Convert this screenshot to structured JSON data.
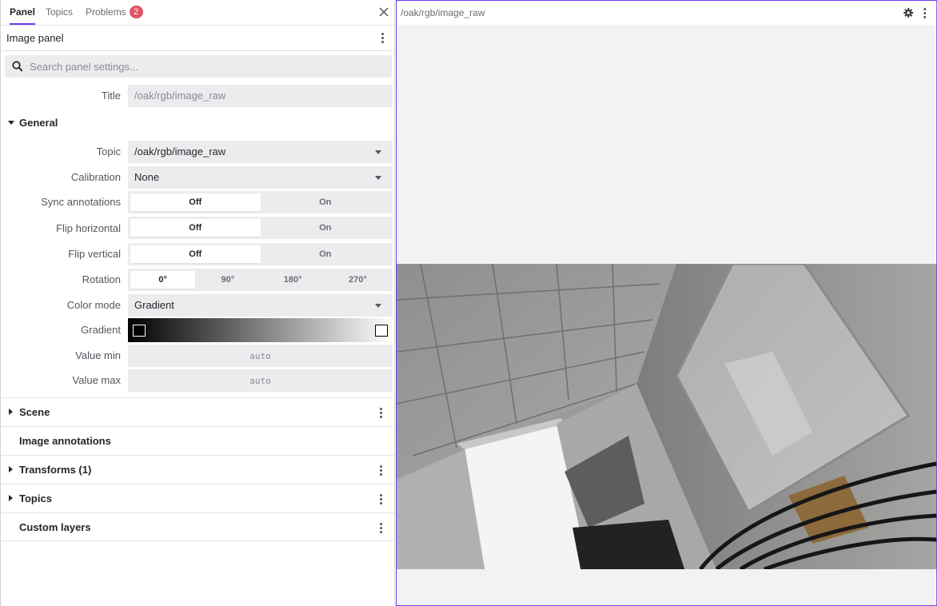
{
  "sidebar": {
    "tabs": [
      {
        "label": "Panel"
      },
      {
        "label": "Topics"
      },
      {
        "label": "Problems",
        "badge": "2"
      }
    ],
    "panel_title": "Image panel",
    "search_placeholder": "Search panel settings...",
    "title_field": {
      "label": "Title",
      "value": "/oak/rgb/image_raw"
    },
    "general": {
      "label": "General",
      "topic": {
        "label": "Topic",
        "value": "/oak/rgb/image_raw"
      },
      "calibration": {
        "label": "Calibration",
        "value": "None"
      },
      "sync_annotations": {
        "label": "Sync annotations",
        "options": [
          "Off",
          "On"
        ],
        "selected": "Off"
      },
      "flip_horizontal": {
        "label": "Flip horizontal",
        "options": [
          "Off",
          "On"
        ],
        "selected": "Off"
      },
      "flip_vertical": {
        "label": "Flip vertical",
        "options": [
          "Off",
          "On"
        ],
        "selected": "Off"
      },
      "rotation": {
        "label": "Rotation",
        "options": [
          "0°",
          "90°",
          "180°",
          "270°"
        ],
        "selected": "0°"
      },
      "color_mode": {
        "label": "Color mode",
        "value": "Gradient"
      },
      "gradient": {
        "label": "Gradient",
        "min_color": "#000000",
        "max_color": "#ffffff"
      },
      "value_min": {
        "label": "Value min",
        "placeholder": "auto"
      },
      "value_max": {
        "label": "Value max",
        "placeholder": "auto"
      }
    },
    "sections": [
      {
        "label": "Scene",
        "expandable": true,
        "menu": true
      },
      {
        "label": "Image annotations",
        "expandable": false,
        "menu": false
      },
      {
        "label": "Transforms (1)",
        "expandable": true,
        "menu": true
      },
      {
        "label": "Topics",
        "expandable": true,
        "menu": true
      },
      {
        "label": "Custom layers",
        "expandable": false,
        "menu": true
      }
    ]
  },
  "image_panel": {
    "topic": "/oak/rgb/image_raw"
  },
  "colors": {
    "accent": "#6f3be8",
    "badge": "#e05465"
  }
}
